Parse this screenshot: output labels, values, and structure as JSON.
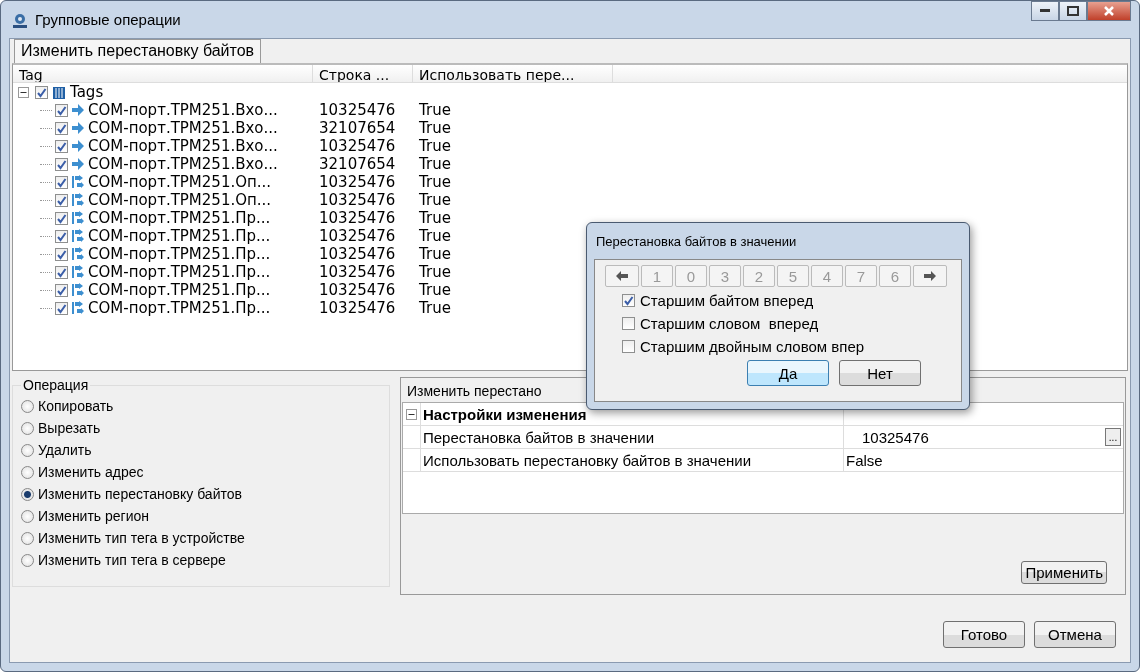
{
  "window": {
    "title": "Групповые операции"
  },
  "tabs": [
    {
      "label": "Изменить перестановку байтов",
      "selected": true
    }
  ],
  "tree": {
    "columns": [
      "Tag",
      "Строка ...",
      "Использовать пере..."
    ],
    "root": {
      "label": "Tags",
      "checked": true,
      "expanded": true,
      "children": [
        {
          "kind": "input",
          "name": "COM-порт.ТРМ251.Вхо...",
          "value": "10325476",
          "use": "True",
          "checked": true
        },
        {
          "kind": "input",
          "name": "COM-порт.ТРМ251.Вхо...",
          "value": "32107654",
          "use": "True",
          "checked": true
        },
        {
          "kind": "input",
          "name": "COM-порт.ТРМ251.Вхо...",
          "value": "10325476",
          "use": "True",
          "checked": true
        },
        {
          "kind": "input",
          "name": "COM-порт.ТРМ251.Вхо...",
          "value": "32107654",
          "use": "True",
          "checked": true
        },
        {
          "kind": "exchange",
          "name": "COM-порт.ТРМ251.Оп...",
          "value": "10325476",
          "use": "True",
          "checked": true
        },
        {
          "kind": "exchange",
          "name": "COM-порт.ТРМ251.Оп...",
          "value": "10325476",
          "use": "True",
          "checked": true
        },
        {
          "kind": "exchange",
          "name": "COM-порт.ТРМ251.Пр...",
          "value": "10325476",
          "use": "True",
          "checked": true
        },
        {
          "kind": "exchange",
          "name": "COM-порт.ТРМ251.Пр...",
          "value": "10325476",
          "use": "True",
          "checked": true
        },
        {
          "kind": "exchange",
          "name": "COM-порт.ТРМ251.Пр...",
          "value": "10325476",
          "use": "True",
          "checked": true
        },
        {
          "kind": "exchange",
          "name": "COM-порт.ТРМ251.Пр...",
          "value": "10325476",
          "use": "True",
          "checked": true
        },
        {
          "kind": "exchange",
          "name": "COM-порт.ТРМ251.Пр...",
          "value": "10325476",
          "use": "True",
          "checked": true
        },
        {
          "kind": "exchange",
          "name": "COM-порт.ТРМ251.Пр...",
          "value": "10325476",
          "use": "True",
          "checked": true
        }
      ]
    }
  },
  "operation": {
    "title": "Операция",
    "options": [
      {
        "label": "Копировать",
        "selected": false
      },
      {
        "label": "Вырезать",
        "selected": false
      },
      {
        "label": "Удалить",
        "selected": false
      },
      {
        "label": "Изменить адрес",
        "selected": false
      },
      {
        "label": "Изменить перестановку байтов",
        "selected": true
      },
      {
        "label": "Изменить регион",
        "selected": false
      },
      {
        "label": "Изменить тип тега в устройстве",
        "selected": false
      },
      {
        "label": "Изменить тип тега в сервере",
        "selected": false
      }
    ]
  },
  "settings": {
    "title": "Изменить перестано",
    "category": "Настройки изменения",
    "expanded": true,
    "properties": [
      {
        "name": "Перестановка байтов в значении",
        "value": "10325476",
        "has_button": true,
        "button": "..."
      },
      {
        "name": "Использовать перестановку байтов в значении",
        "value": "False",
        "has_button": false
      }
    ],
    "apply": "Применить"
  },
  "dialog": {
    "title": "Перестановка байтов в значении",
    "order": [
      "1",
      "0",
      "3",
      "2",
      "5",
      "4",
      "7",
      "6"
    ],
    "options": [
      {
        "label": "Старшим байтом вперед",
        "checked": true
      },
      {
        "label": "Старшим словом  вперед",
        "checked": false
      },
      {
        "label": "Старшим двойным словом впер",
        "checked": false
      }
    ],
    "yes": "Да",
    "no": "Нет"
  },
  "footer": {
    "done": "Готово",
    "cancel": "Отмена"
  }
}
